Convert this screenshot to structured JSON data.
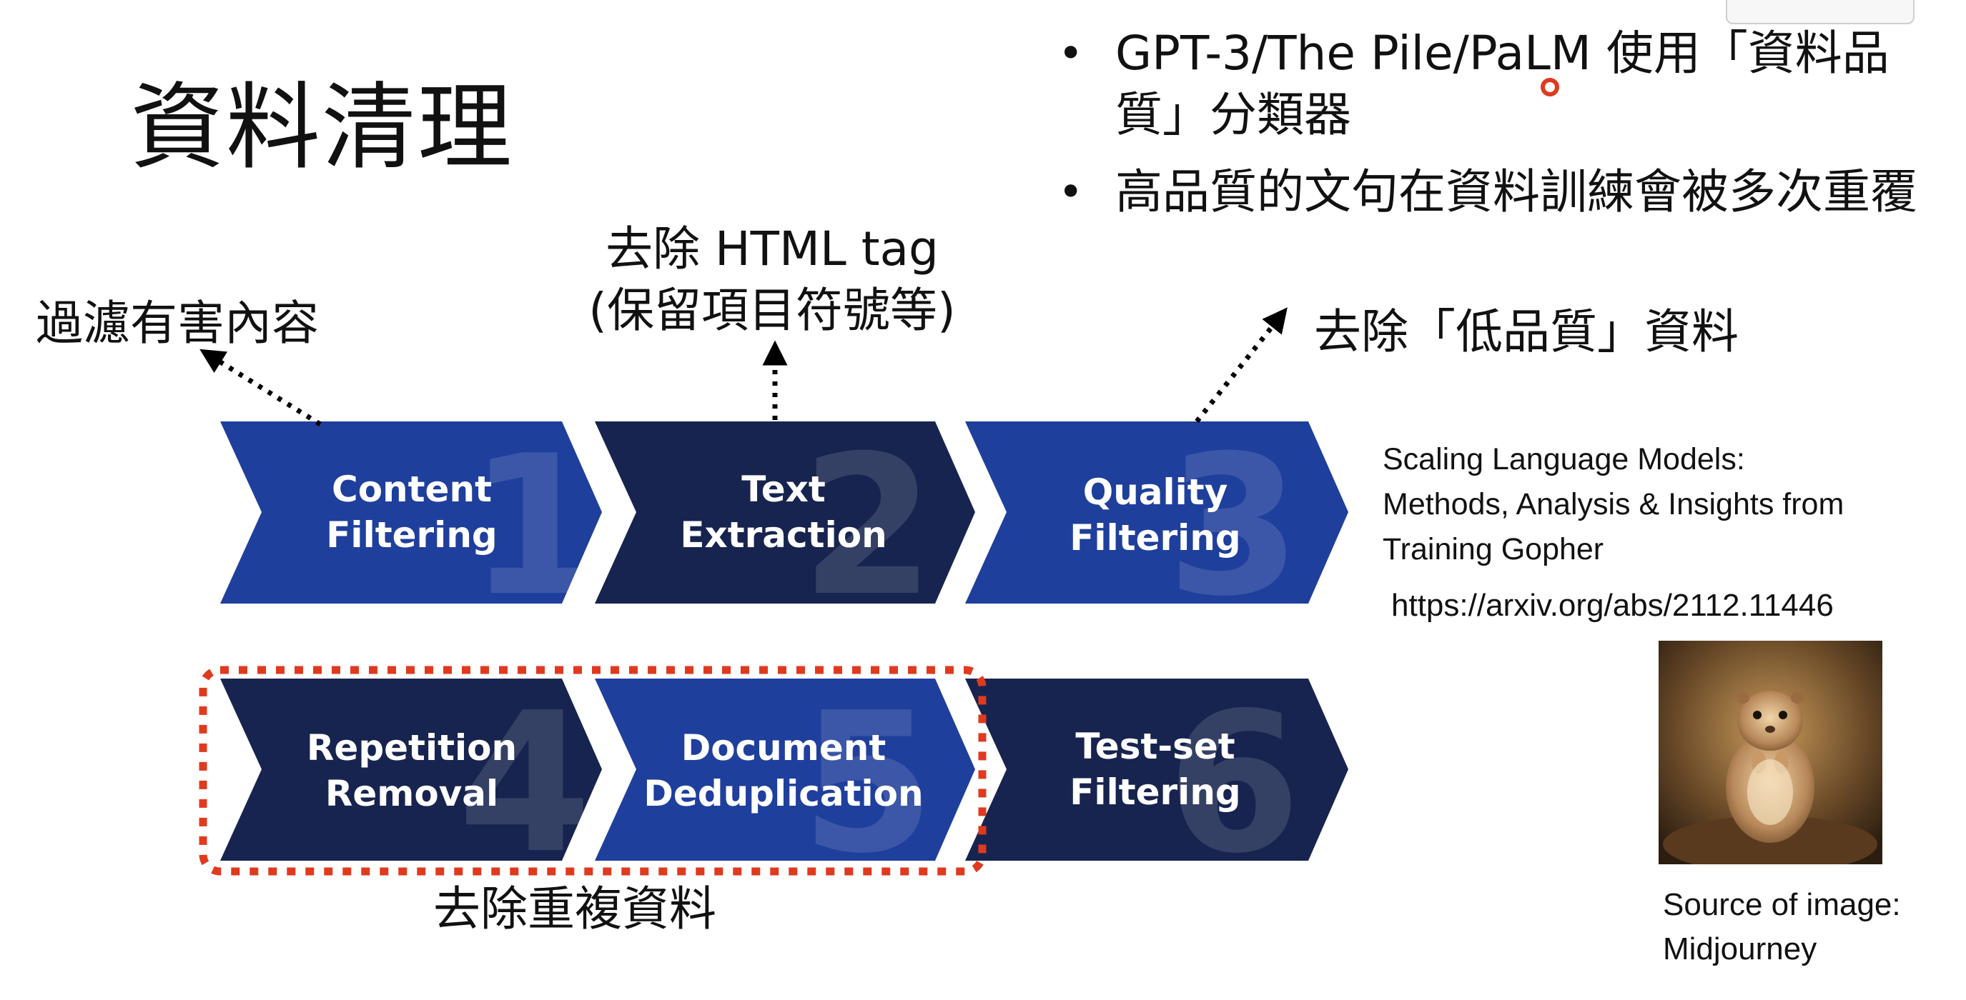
{
  "slide": {
    "title": "資料清理",
    "bullets": [
      "GPT-3/The Pile/PaLM 使用「資料品質」分類器",
      "高品質的文句在資料訓練會被多次重覆"
    ],
    "bullet_symbol": "•",
    "annotations": {
      "content_filter": "過濾有害內容",
      "html_line1": "去除 HTML tag",
      "html_line2": "(保留項目符號等)",
      "low_quality": "去除「低品質」資料",
      "dedup": "去除重複資料"
    },
    "steps": [
      {
        "number": "1",
        "line1": "Content",
        "line2": "Filtering",
        "color": "#1f3f9c"
      },
      {
        "number": "2",
        "line1": "Text",
        "line2": "Extraction",
        "color": "#17244f"
      },
      {
        "number": "3",
        "line1": "Quality",
        "line2": "Filtering",
        "color": "#1f3f9c"
      },
      {
        "number": "4",
        "line1": "Repetition",
        "line2": "Removal",
        "color": "#17244f"
      },
      {
        "number": "5",
        "line1": "Document",
        "line2": "Deduplication",
        "color": "#1f3f9c"
      },
      {
        "number": "6",
        "line1": "Test-set",
        "line2": "Filtering",
        "color": "#17244f"
      }
    ],
    "reference": {
      "line1": "Scaling Language Models:",
      "line2": "Methods, Analysis & Insights from",
      "line3": "Training Gopher",
      "url": "https://arxiv.org/abs/2112.11446"
    },
    "image_source": {
      "line1": "Source of image:",
      "line2": "Midjourney"
    },
    "colors": {
      "blue": "#1f3f9c",
      "navy": "#17244f",
      "highlight": "#e03a1e"
    }
  }
}
